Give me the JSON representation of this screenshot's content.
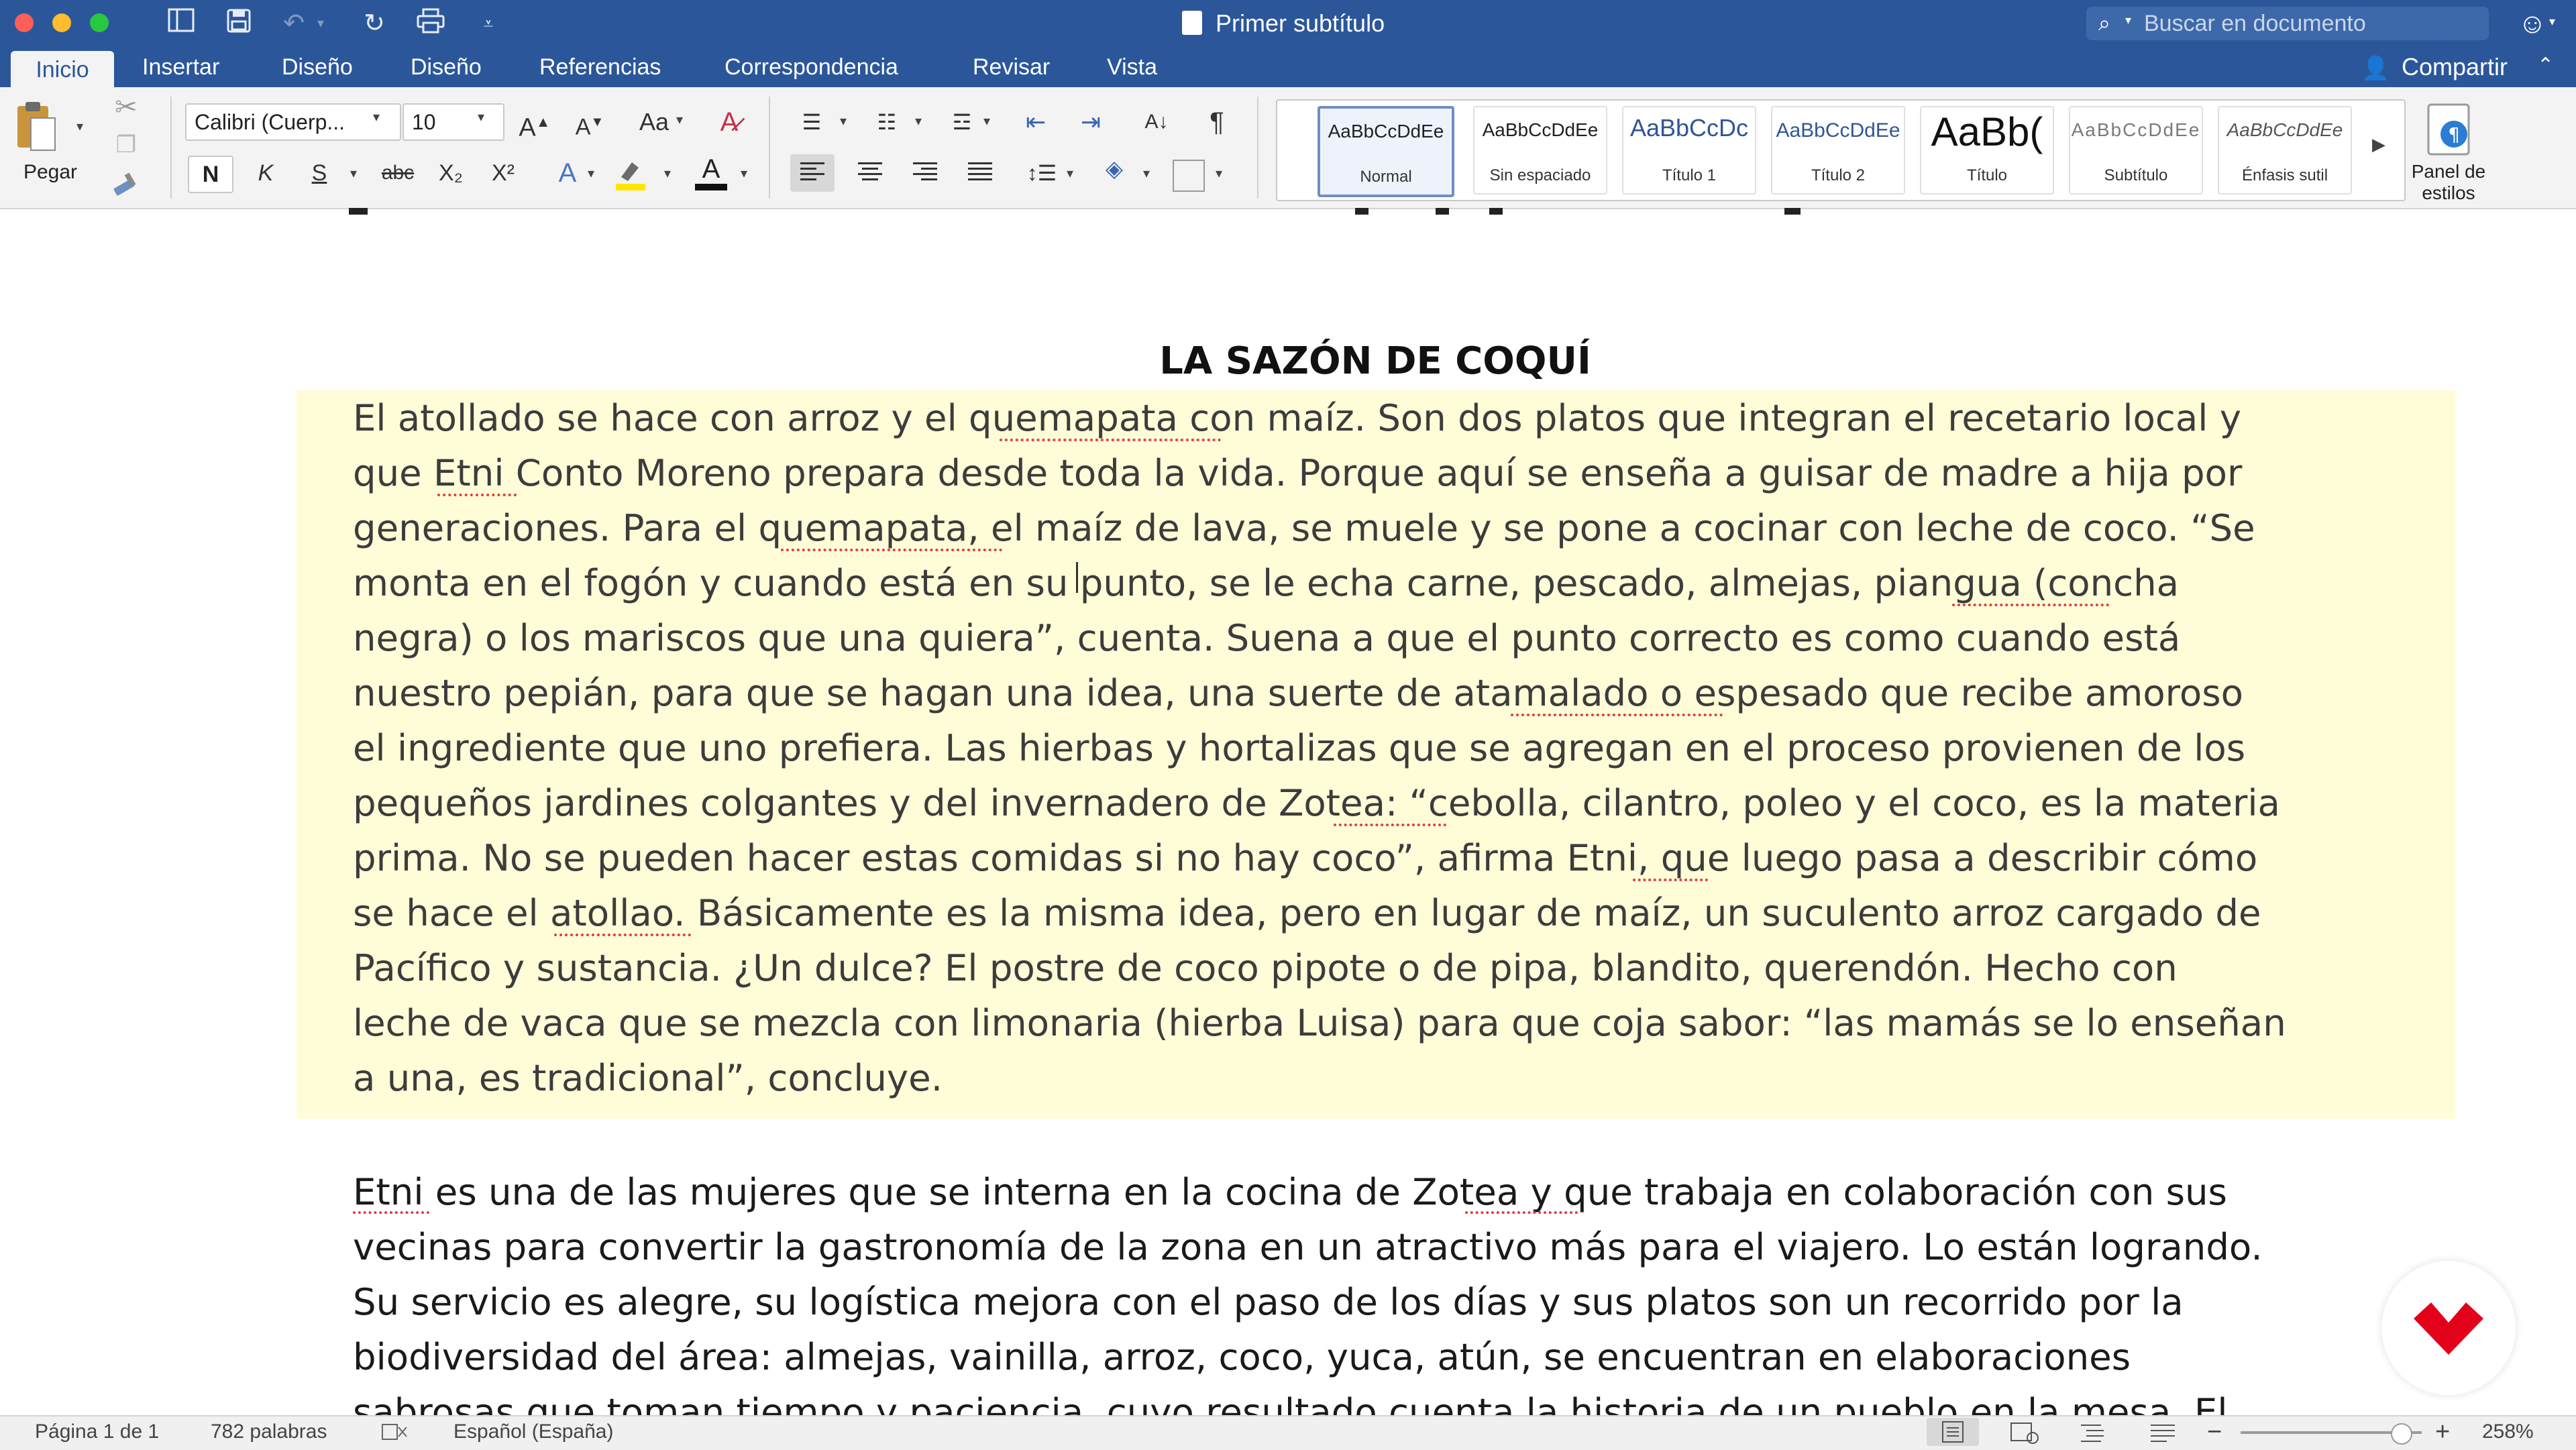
{
  "window": {
    "title": "Primer subtítulo",
    "search_placeholder": "Buscar en documento"
  },
  "tabs": [
    {
      "label": "Inicio",
      "active": true
    },
    {
      "label": "Insertar"
    },
    {
      "label": "Diseño"
    },
    {
      "label": "Diseño"
    },
    {
      "label": "Referencias"
    },
    {
      "label": "Correspondencia"
    },
    {
      "label": "Revisar"
    },
    {
      "label": "Vista"
    }
  ],
  "share_label": "Compartir",
  "ribbon": {
    "paste_label": "Pegar",
    "font_name": "Calibri (Cuerp...",
    "font_size": "10",
    "bold": "N",
    "italic": "K",
    "underline": "S",
    "strike": "abc",
    "subscript": "X₂",
    "superscript": "X²",
    "styles": [
      {
        "sample": "AaBbCcDdEe",
        "name": "Normal",
        "selected": true
      },
      {
        "sample": "AaBbCcDdEe",
        "name": "Sin espaciado"
      },
      {
        "sample": "AaBbCcDc",
        "name": "Título 1"
      },
      {
        "sample": "AaBbCcDdEe",
        "name": "Título 2"
      },
      {
        "sample": "AaBb(",
        "name": "Título"
      },
      {
        "sample": "AaBbCcDdEe",
        "name": "Subtítulo"
      },
      {
        "sample": "AaBbCcDdEe",
        "name": "Énfasis sutil"
      }
    ],
    "styles_pane_label_1": "Panel de",
    "styles_pane_label_2": "estilos"
  },
  "document": {
    "heading": "LA SAZÓN DE COQUÍ",
    "highlighted_lines": [
      "El atollado se hace con arroz y el quemapata con maíz. Son dos platos que integran el recetario local y",
      "que Etni Conto Moreno prepara desde toda la vida. Porque aquí se enseña a guisar de madre a hija por",
      "generaciones. Para el quemapata, el maíz de lava, se muele y se pone a cocinar con leche de coco. “Se",
      "monta en el fogón y cuando está en su punto, se le echa carne, pescado, almejas, piangua (concha",
      "negra) o los mariscos que una quiera”, cuenta. Suena a que el punto correcto es como cuando está",
      "nuestro pepián, para que se hagan una idea, una suerte de atamalado o espesado que recibe amoroso",
      "el ingrediente que uno prefiera. Las hierbas y hortalizas que se agregan en el proceso provienen de los",
      "pequeños jardines colgantes y del invernadero de Zotea: “cebolla, cilantro, poleo y el coco, es la materia",
      "prima. No se pueden hacer estas comidas si no hay coco”, afirma Etni, que luego pasa a describir cómo",
      "se hace el atollao. Básicamente es la misma idea, pero en lugar de maíz, un suculento arroz cargado de",
      "Pacífico y sustancia. ¿Un dulce? El postre de coco pipote o de pipa, blandito, querendón. Hecho con",
      "leche de vaca que se mezcla con limonaria (hierba Luisa) para que coja sabor: “las mamás se lo enseñan",
      "a una, es tradicional”, concluye."
    ],
    "body_lines": [
      "Etni es una de las mujeres que se interna en la cocina de Zotea y que trabaja en colaboración con sus",
      "vecinas para convertir la gastronomía de la zona en un atractivo más para el viajero. Lo están logrando.",
      "Su servicio es alegre, su logística mejora con el paso de los días y sus platos son un recorrido por la",
      "biodiversidad del área: almejas, vainilla, arroz, coco, yuca, atún, se encuentran en elaboraciones",
      "sabrosas que toman tiempo y paciencia, cuyo resultado cuenta la historia de un pueblo en la mesa. El"
    ]
  },
  "status": {
    "page": "Página 1 de 1",
    "words": "782 palabras",
    "language": "Español (España)",
    "zoom": "258%",
    "zoom_level": 0.88
  },
  "colors": {
    "accent": "#2b579a",
    "highlight": "#fefdd8",
    "logo": "#e3001b"
  }
}
